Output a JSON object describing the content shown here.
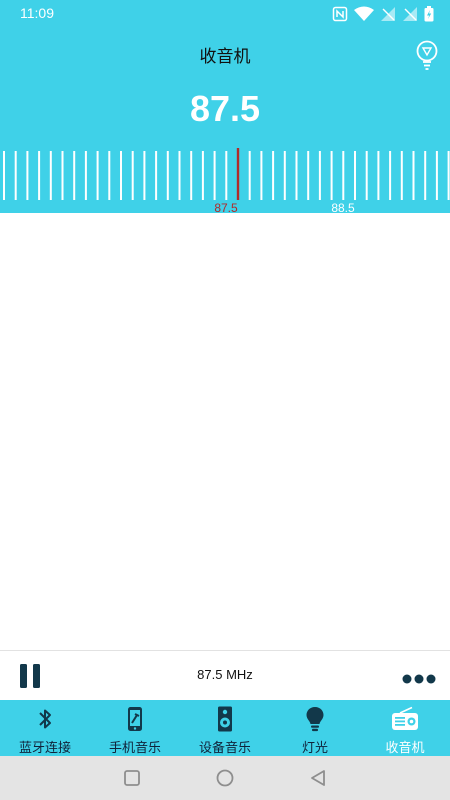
{
  "status": {
    "time": "11:09"
  },
  "header": {
    "title": "收音机",
    "frequency": "87.5"
  },
  "dial": {
    "current": 87.5,
    "labels": [
      {
        "text": "87.5",
        "value": 87.5
      },
      {
        "text": "88.5",
        "value": 88.5
      }
    ],
    "marker_color": "#b02a2a",
    "label_color_active": "#b02a2a"
  },
  "player": {
    "frequency_label": "87.5 MHz",
    "state": "playing"
  },
  "tabs": [
    {
      "label": "蓝牙连接",
      "icon": "bluetooth-icon"
    },
    {
      "label": "手机音乐",
      "icon": "phone-music-icon"
    },
    {
      "label": "设备音乐",
      "icon": "speaker-icon"
    },
    {
      "label": "灯光",
      "icon": "lightbulb-icon"
    },
    {
      "label": "收音机",
      "icon": "radio-icon",
      "active": true
    }
  ],
  "colors": {
    "accent": "#3fd1e8",
    "icon_dark": "#12384a"
  }
}
